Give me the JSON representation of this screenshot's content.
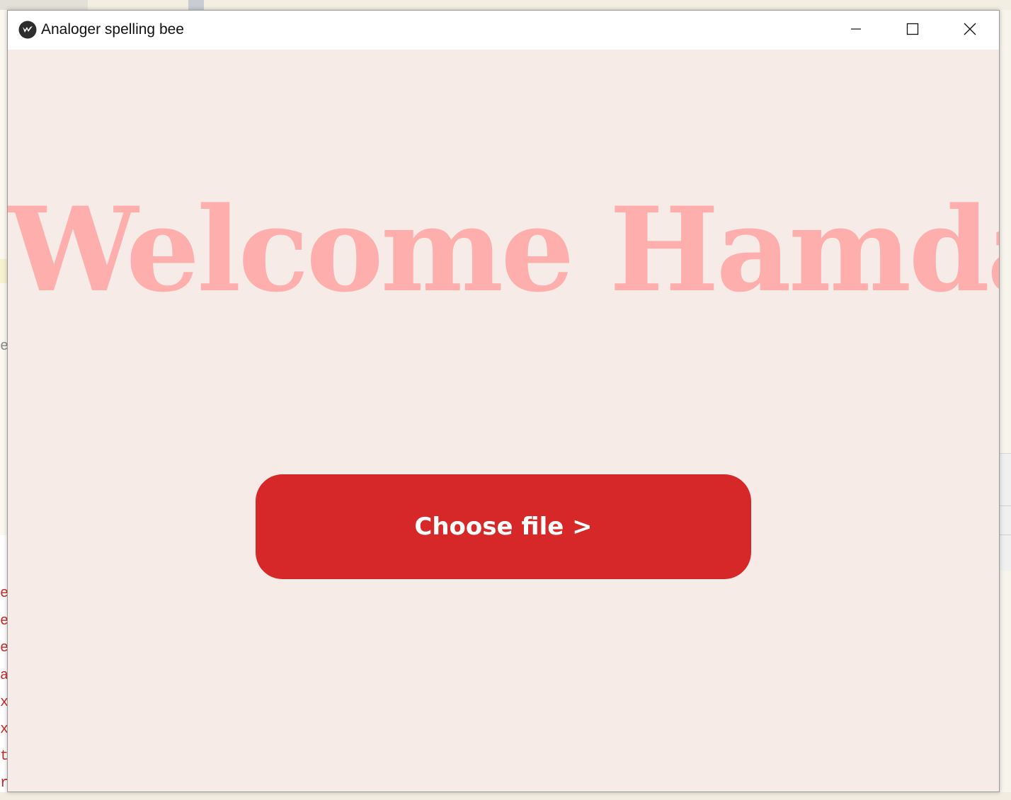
{
  "window": {
    "title": "Analoger spelling bee",
    "controls": {
      "minimize_icon": "minimize-icon",
      "maximize_icon": "maximize-icon",
      "close_icon": "close-icon"
    }
  },
  "main": {
    "heading": "Welcome Hamdan",
    "choose_file_label": "Choose file >"
  },
  "background": {
    "left_fragments": [
      "e",
      "e",
      "e",
      "e",
      "a",
      "x",
      "x",
      "t",
      "r"
    ]
  },
  "colors": {
    "heading": "#ffaeae",
    "button": "#d62828",
    "client_background": "#f7ebe8"
  }
}
